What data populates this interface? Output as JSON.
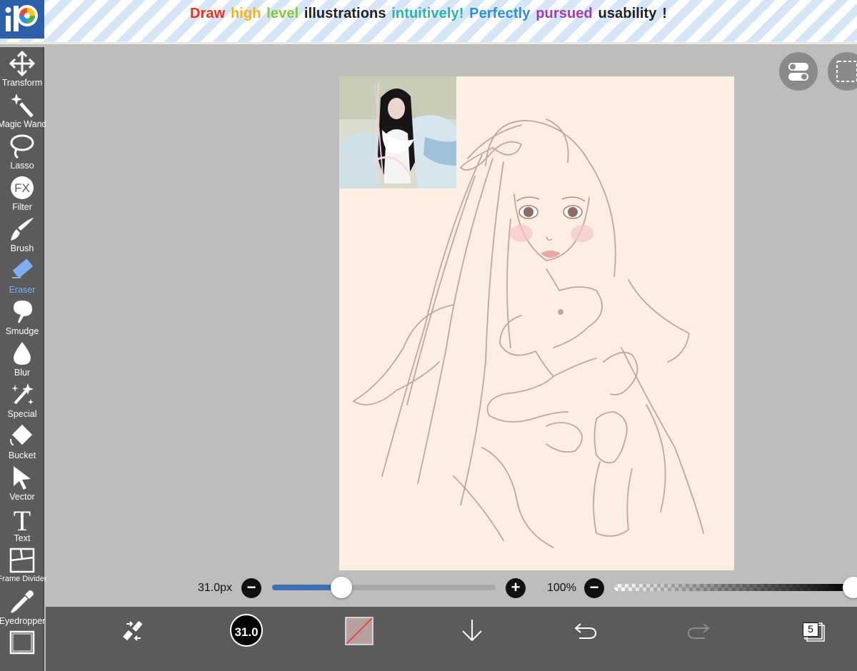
{
  "banner": {
    "tagline_words": [
      {
        "text": "Draw",
        "color": "#e8321e"
      },
      {
        "text": "high",
        "color": "#f2b21a"
      },
      {
        "text": "level",
        "color": "#8cc63f"
      },
      {
        "text": "illustrations",
        "color": "#222222"
      },
      {
        "text": "intuitively!",
        "color": "#2fb3a8"
      },
      {
        "text": "Perfectly",
        "color": "#2a8fe0"
      },
      {
        "text": "pursued",
        "color": "#9b3db8"
      },
      {
        "text": "usability",
        "color": "#222222"
      },
      {
        "text": "!",
        "color": "#222222"
      }
    ]
  },
  "toolbar": {
    "items": [
      {
        "label": "Transform",
        "icon": "move-arrows-icon"
      },
      {
        "label": "Magic Wand",
        "icon": "magic-wand-icon"
      },
      {
        "label": "Lasso",
        "icon": "lasso-icon"
      },
      {
        "label": "Filter",
        "icon": "fx-icon",
        "glyph": "FX"
      },
      {
        "label": "Brush",
        "icon": "brush-icon"
      },
      {
        "label": "Eraser",
        "icon": "eraser-icon",
        "active": true
      },
      {
        "label": "Smudge",
        "icon": "smudge-icon"
      },
      {
        "label": "Blur",
        "icon": "drop-icon"
      },
      {
        "label": "Special",
        "icon": "sparkle-icon"
      },
      {
        "label": "Bucket",
        "icon": "bucket-icon"
      },
      {
        "label": "Vector",
        "icon": "cursor-arrow-icon"
      },
      {
        "label": "Text",
        "icon": "text-icon",
        "glyph": "T"
      },
      {
        "label": "Frame Divider",
        "icon": "frame-divider-icon"
      },
      {
        "label": "Eyedropper",
        "icon": "eyedropper-icon"
      },
      {
        "label": "",
        "icon": "canvas-icon"
      }
    ],
    "active_color": "#7eb0f0"
  },
  "sliders": {
    "brush_size": {
      "label": "31.0px",
      "value_fraction": 0.31
    },
    "opacity": {
      "label": "100%",
      "value_fraction": 1.0
    }
  },
  "bottom_bar": {
    "brush_size_value": "31.0",
    "layer_count": "5",
    "icons": [
      "swap-tools-icon",
      "brush-size-icon",
      "color-swatch-icon",
      "download-arrow-icon",
      "undo-icon",
      "redo-icon",
      "layers-icon"
    ]
  },
  "colors": {
    "canvas_bg": "#fcefe1",
    "sketch_line": "#c4a39f",
    "toolbar_bg": "#5b5b5b",
    "slider_fill": "#3f6fb5"
  }
}
